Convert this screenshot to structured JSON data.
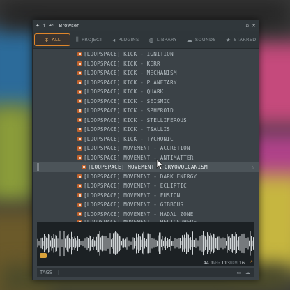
{
  "window": {
    "title": "Browser",
    "title_icons": [
      "arrows-icon",
      "up-arrow-icon",
      "back-icon"
    ],
    "controls": [
      "maximize-icon",
      "close-icon"
    ]
  },
  "tabs": [
    {
      "label": "ALL",
      "icon": "all-icon",
      "active": true
    },
    {
      "label": "PROJECT",
      "icon": "project-icon",
      "active": false
    },
    {
      "label": "PLUGINS",
      "icon": "plugins-icon",
      "active": false
    },
    {
      "label": "LIBRARY",
      "icon": "library-icon",
      "active": false
    },
    {
      "label": "SOUNDS",
      "icon": "cloud-icon",
      "active": false
    },
    {
      "label": "STARRED",
      "icon": "star-icon",
      "active": false
    }
  ],
  "files": [
    {
      "name": "[LOOPSPACE] KICK - IGNITION"
    },
    {
      "name": "[LOOPSPACE] KICK - KERR"
    },
    {
      "name": "[LOOPSPACE] KICK - MECHANISM"
    },
    {
      "name": "[LOOPSPACE] KICK - PLANETARY"
    },
    {
      "name": "[LOOPSPACE] KICK - QUARK"
    },
    {
      "name": "[LOOPSPACE] KICK - SEISMIC"
    },
    {
      "name": "[LOOPSPACE] KICK - SPHEROID"
    },
    {
      "name": "[LOOPSPACE] KICK - STELLIFEROUS"
    },
    {
      "name": "[LOOPSPACE] KICK - TSALLIS"
    },
    {
      "name": "[LOOPSPACE] KICK - TYCHONIC"
    },
    {
      "name": "[LOOPSPACE] MOVEMENT - ACCRETION"
    },
    {
      "name": "[LOOPSPACE] MOVEMENT - ANTIMATTER"
    },
    {
      "name": "[LOOPSPACE] MOVEMENT - CRYOVOLCANISM",
      "selected": true
    },
    {
      "name": "[LOOPSPACE] MOVEMENT - DARK ENERGY"
    },
    {
      "name": "[LOOPSPACE] MOVEMENT - ECLIPTIC"
    },
    {
      "name": "[LOOPSPACE] MOVEMENT - FUSION"
    },
    {
      "name": "[LOOPSPACE] MOVEMENT - GIBBOUS"
    },
    {
      "name": "[LOOPSPACE] MOVEMENT - HADAL ZONE"
    },
    {
      "name": "[LOOPSPACE] MOVEMENT - HELIOSPHERE"
    }
  ],
  "preview": {
    "sample_rate": "44.1",
    "sample_rate_unit": "kHz",
    "bpm": "113",
    "bpm_unit": "BPM",
    "bits": "16"
  },
  "bottom_bar": {
    "tags_label": "TAGS"
  },
  "colors": {
    "accent": "#e0862a",
    "panel": "#3b4247",
    "waveform": "#cfd4d6"
  }
}
